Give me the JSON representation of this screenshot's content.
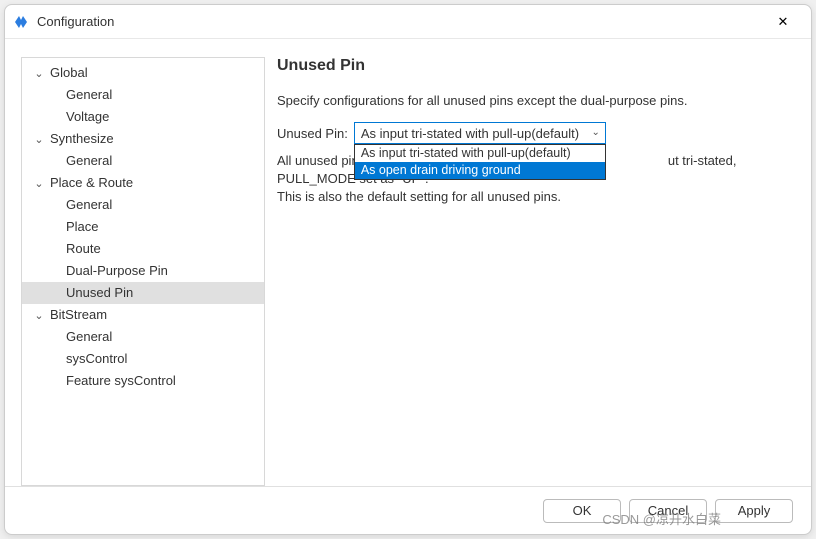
{
  "window": {
    "title": "Configuration",
    "close_glyph": "✕"
  },
  "tree": {
    "items": [
      {
        "label": "Global",
        "type": "parent",
        "expanded": true
      },
      {
        "label": "General",
        "type": "child"
      },
      {
        "label": "Voltage",
        "type": "child"
      },
      {
        "label": "Synthesize",
        "type": "parent",
        "expanded": true
      },
      {
        "label": "General",
        "type": "child"
      },
      {
        "label": "Place & Route",
        "type": "parent",
        "expanded": true
      },
      {
        "label": "General",
        "type": "child"
      },
      {
        "label": "Place",
        "type": "child"
      },
      {
        "label": "Route",
        "type": "child"
      },
      {
        "label": "Dual-Purpose Pin",
        "type": "child"
      },
      {
        "label": "Unused Pin",
        "type": "child",
        "selected": true
      },
      {
        "label": "BitStream",
        "type": "parent",
        "expanded": true
      },
      {
        "label": "General",
        "type": "child"
      },
      {
        "label": "sysControl",
        "type": "child"
      },
      {
        "label": "Feature sysControl",
        "type": "child"
      }
    ]
  },
  "panel": {
    "heading": "Unused Pin",
    "description": "Specify configurations for all unused pins except the dual-purpose pins.",
    "field_label": "Unused Pin:",
    "selected_value": "As input tri-stated with pull-up(default)",
    "options": [
      {
        "label": "As input tri-stated with pull-up(default)",
        "highlight": false
      },
      {
        "label": "As open drain driving ground",
        "highlight": true
      }
    ],
    "body_line1": "All unused pins (input, output, bi-",
    "body_line1_tail": "ut tri-stated, PULL_MODE set as \"UP\".",
    "body_line2": "This is also the default setting for all unused pins."
  },
  "footer": {
    "ok": "OK",
    "cancel": "Cancel",
    "apply": "Apply"
  },
  "watermark": "CSDN @凉开水白菜"
}
